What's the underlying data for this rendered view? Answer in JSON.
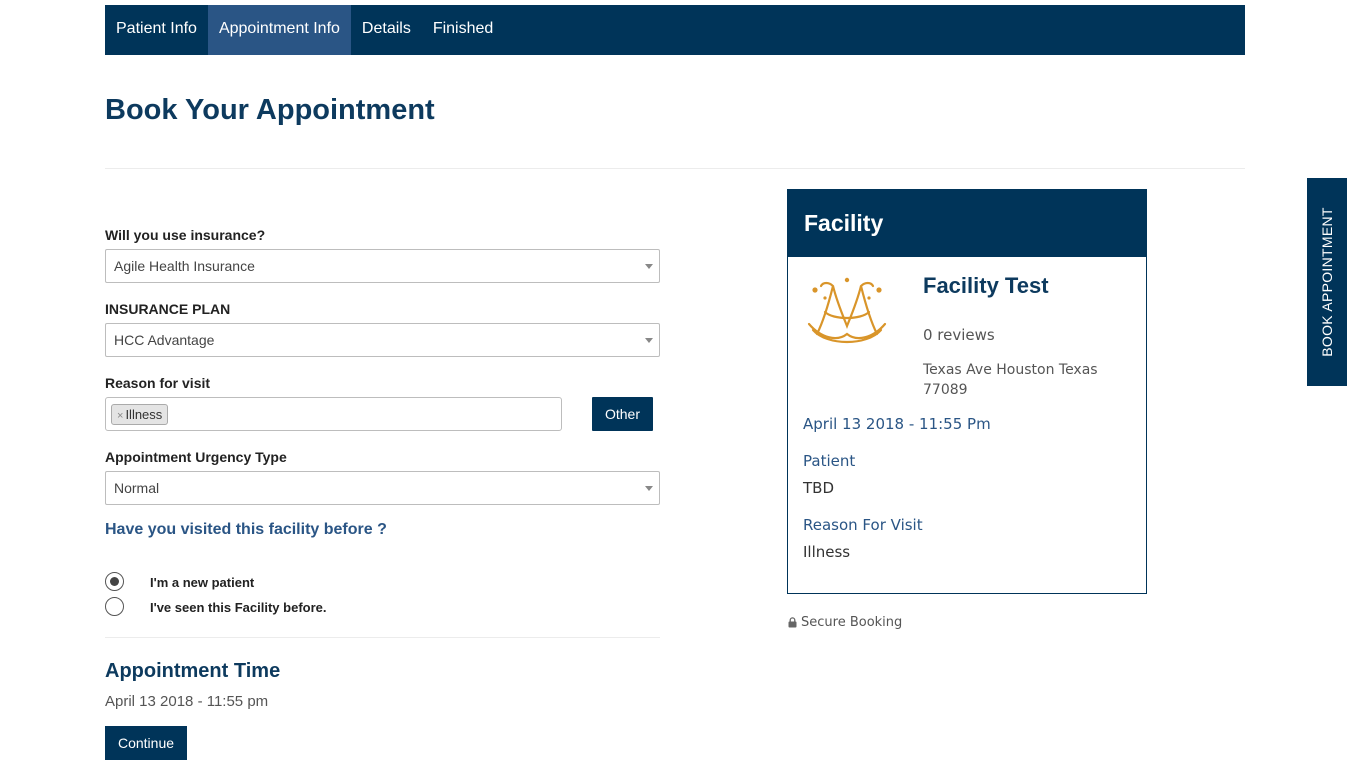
{
  "nav": {
    "tabs": [
      {
        "label": "Patient Info"
      },
      {
        "label": "Appointment Info"
      },
      {
        "label": "Details"
      },
      {
        "label": "Finished"
      }
    ],
    "active_tab": "Appointment Info"
  },
  "page": {
    "title": "Book Your Appointment"
  },
  "form": {
    "insurance_label": "Will you use insurance?",
    "insurance_value": "Agile Health Insurance",
    "plan_label": "INSURANCE PLAN",
    "plan_value": "HCC Advantage",
    "reason_label": "Reason for visit",
    "reason_tag": "Illness",
    "reason_tag_remove": "×",
    "other_button": "Other",
    "urgency_label": "Appointment Urgency Type",
    "urgency_value": "Normal",
    "visited_question": "Have you visited this facility before ?",
    "radio_new": "I'm a new patient",
    "radio_seen": "I've seen this Facility before.",
    "radio_selected": "new",
    "appointment_time_title": "Appointment Time",
    "appointment_time_value": "April 13 2018 - 11:55 pm",
    "continue_button": "Continue"
  },
  "card": {
    "header": "Facility",
    "facility_name": "Facility Test",
    "reviews": "0 reviews",
    "address": "Texas Ave Houston Texas 77089",
    "datetime": "April 13 2018 - 11:55 Pm",
    "patient_label": "Patient",
    "patient_value": "TBD",
    "reason_label": "Reason For Visit",
    "reason_value": "Illness"
  },
  "secure_text": "Secure Booking",
  "side_tab": "BOOK APPOINTMENT",
  "colors": {
    "primary": "#003459",
    "active_tab": "#2a5585",
    "heading": "#0d3a5e",
    "logo_gold": "#d9952a"
  },
  "icons": {
    "lock": "lock-icon",
    "logo": "facility-logo"
  }
}
